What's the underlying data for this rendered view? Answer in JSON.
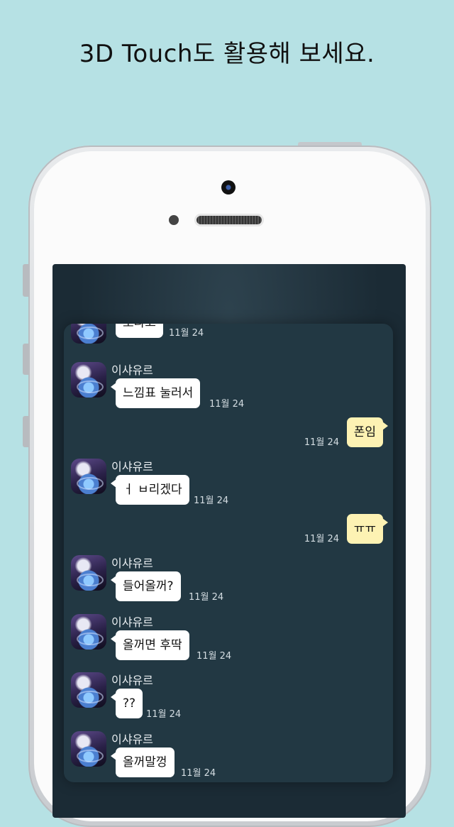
{
  "headline": "3D Touch도 활용해 보세요.",
  "colors": {
    "background": "#b6e1e4",
    "chat_bg": "#223843",
    "incoming_bubble": "#ffffff",
    "outgoing_bubble": "#fdf2b3"
  },
  "chat": {
    "messages": [
      {
        "type": "in",
        "sender": "",
        "text": "오라고",
        "time": "11월 24"
      },
      {
        "type": "in",
        "sender": "이샤유르",
        "text": "느낌표 눌러서",
        "time": "11월 24"
      },
      {
        "type": "out",
        "text": "폰임",
        "time": "11월 24"
      },
      {
        "type": "in",
        "sender": "이샤유르",
        "text": "ㅓ ㅂ리겠다",
        "time": "11월 24"
      },
      {
        "type": "out",
        "text": "ㅠㅠ",
        "time": "11월 24"
      },
      {
        "type": "in",
        "sender": "이샤유르",
        "text": "들어올꺼?",
        "time": "11월 24"
      },
      {
        "type": "in",
        "sender": "이샤유르",
        "text": "올꺼면 후딱",
        "time": "11월 24"
      },
      {
        "type": "in",
        "sender": "이샤유르",
        "text": "??",
        "time": "11월 24"
      },
      {
        "type": "in",
        "sender": "이샤유르",
        "text": "올꺼말껑",
        "time": "11월 24"
      }
    ]
  }
}
